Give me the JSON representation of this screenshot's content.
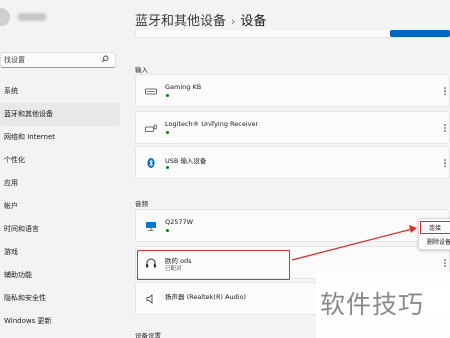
{
  "sidebar": {
    "search_placeholder": "找设置",
    "items": [
      {
        "label": "系统"
      },
      {
        "label": "蓝牙和其他设备"
      },
      {
        "label": "网络和 Internet"
      },
      {
        "label": "个性化"
      },
      {
        "label": "应用"
      },
      {
        "label": "帐户"
      },
      {
        "label": "时间和语言"
      },
      {
        "label": "游戏"
      },
      {
        "label": "辅助功能"
      },
      {
        "label": "隐私和安全性"
      },
      {
        "label": "Windows 更新"
      }
    ]
  },
  "header": {
    "parent": "蓝牙和其他设备",
    "separator": "›",
    "current": "设备"
  },
  "sections": {
    "input": {
      "title": "输入",
      "devices": [
        {
          "name": "Gaming KB",
          "icon": "keyboard-icon"
        },
        {
          "name": "Logitech® Unifying Receiver",
          "icon": "keyboard-mouse-icon"
        },
        {
          "name": "USB 输入设备",
          "icon": "bluetooth-icon"
        }
      ]
    },
    "audio": {
      "title": "音频",
      "devices": [
        {
          "name": "Q2577W",
          "icon": "monitor-icon",
          "status": ""
        },
        {
          "name": "欧的    ods",
          "icon": "headphones-icon",
          "status": "已配对"
        },
        {
          "name": "扬声器 (Realtek(R) Audio)",
          "icon": "speaker-icon",
          "status": ""
        }
      ]
    },
    "other_title": "设备设置"
  },
  "context_menu": {
    "connect": "连接",
    "remove": "删除设备"
  },
  "watermark": "软件技巧",
  "colors": {
    "accent": "#0067c0",
    "annotation": "#d9302c",
    "status_green": "#0f7b0f"
  }
}
